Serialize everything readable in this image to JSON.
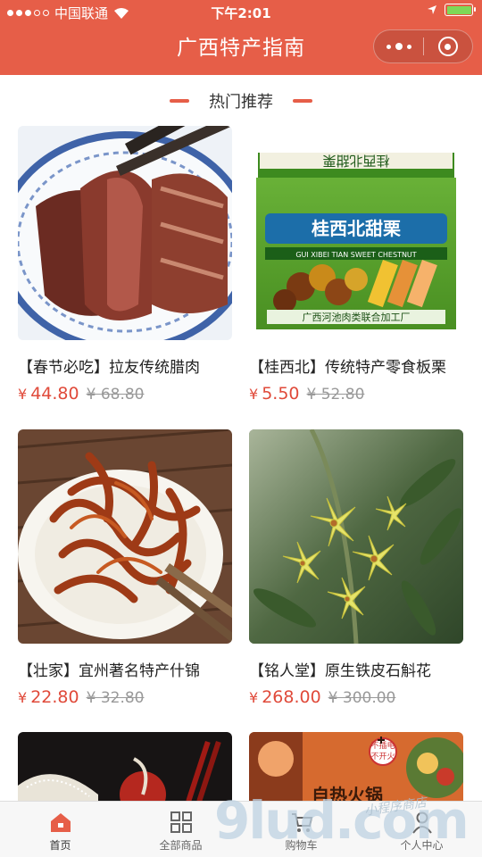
{
  "status_bar": {
    "carrier": "中国联通",
    "time": "下午2:01"
  },
  "nav": {
    "title": "广西特产指南"
  },
  "section": {
    "title": "热门推荐"
  },
  "products": [
    {
      "name": "【春节必吃】拉友传统腊肉",
      "currency": "¥",
      "price": "44.80",
      "old_price": "¥ 68.80"
    },
    {
      "name": "【桂西北】传统特产零食板栗",
      "currency": "¥",
      "price": "5.50",
      "old_price": "¥ 52.80"
    },
    {
      "name": "【壮家】宜州著名特产什锦",
      "currency": "¥",
      "price": "22.80",
      "old_price": "¥ 32.80"
    },
    {
      "name": "【铭人堂】原生铁皮石斛花",
      "currency": "¥",
      "price": "268.00",
      "old_price": "¥ 300.00"
    }
  ],
  "box_label": {
    "line1": "桂西北甜栗",
    "line2": "GUI XIBEI TIAN SWEET CHESTNUT",
    "line3": "广西河池肉类联合加工厂"
  },
  "banner_text": {
    "stamp": "不插电\n不开火",
    "headline": "自热火锅"
  },
  "tabs": [
    {
      "label": "首页",
      "icon": "home-icon"
    },
    {
      "label": "全部商品",
      "icon": "grid-icon"
    },
    {
      "label": "购物车",
      "icon": "cart-icon"
    },
    {
      "label": "个人中心",
      "icon": "person-icon"
    }
  ],
  "watermark": {
    "main": "9lud.com",
    "sub": "小程序商店"
  },
  "colors": {
    "accent": "#e65e48",
    "price": "#e04a3a",
    "battery": "#7ed957"
  }
}
